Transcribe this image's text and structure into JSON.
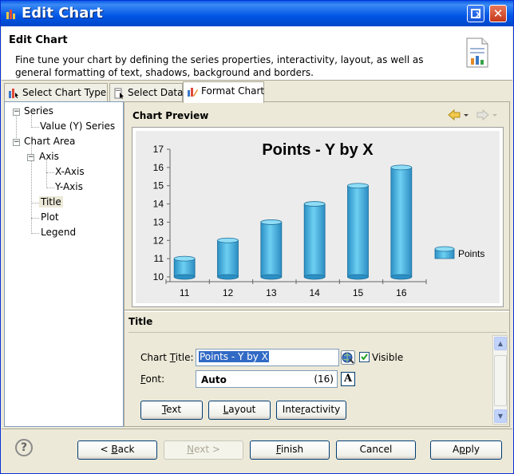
{
  "window": {
    "title": "Edit Chart"
  },
  "header": {
    "title": "Edit Chart",
    "description": "Fine tune your chart by defining the series properties, interactivity, layout, as well as general formatting of text, shadows, background and borders."
  },
  "tabs": [
    {
      "label": "Select Chart Type"
    },
    {
      "label": "Select Data"
    },
    {
      "label": "Format Chart"
    }
  ],
  "tree": {
    "series": "Series",
    "value_series": "Value (Y) Series",
    "chart_area": "Chart Area",
    "axis": "Axis",
    "x_axis": "X-Axis",
    "y_axis": "Y-Axis",
    "title": "Title",
    "plot": "Plot",
    "legend": "Legend"
  },
  "preview": {
    "label": "Chart Preview"
  },
  "chart_data": {
    "type": "bar",
    "title": "Points - Y by X",
    "categories": [
      "11",
      "12",
      "13",
      "14",
      "15",
      "16"
    ],
    "series": [
      {
        "name": "Points",
        "values": [
          11,
          12,
          13,
          14,
          15,
          16
        ]
      }
    ],
    "yticks": [
      "10",
      "11",
      "12",
      "13",
      "14",
      "15",
      "16",
      "17"
    ],
    "ylim": [
      10,
      17
    ],
    "xlabel": "",
    "ylabel": "",
    "legend": "right",
    "bar_color": "#4fb3e0"
  },
  "section": {
    "title": "Title"
  },
  "form": {
    "chart_title_label_pre": "Chart ",
    "chart_title_label_u": "T",
    "chart_title_label_post": "itle:",
    "chart_title_value": "Points - Y by X",
    "visible_label": "Visible",
    "visible_checked": true,
    "font_label_pre": "F",
    "font_label_post": "ont:",
    "font_value": "Auto",
    "font_size": "(16)"
  },
  "buttons": {
    "text_u": "T",
    "text_rest": "ext",
    "layout_u": "L",
    "layout_rest": "ayout",
    "inter_pre": "Inte",
    "inter_u": "r",
    "inter_rest": "activity"
  },
  "footer": {
    "help": "?",
    "back_pre": "< ",
    "back_u": "B",
    "back_rest": "ack",
    "next_u": "N",
    "next_rest": "ext >",
    "finish_u": "F",
    "finish_rest": "inish",
    "cancel": "Cancel",
    "apply_pre": "A",
    "apply_u": "p",
    "apply_rest": "ply"
  }
}
